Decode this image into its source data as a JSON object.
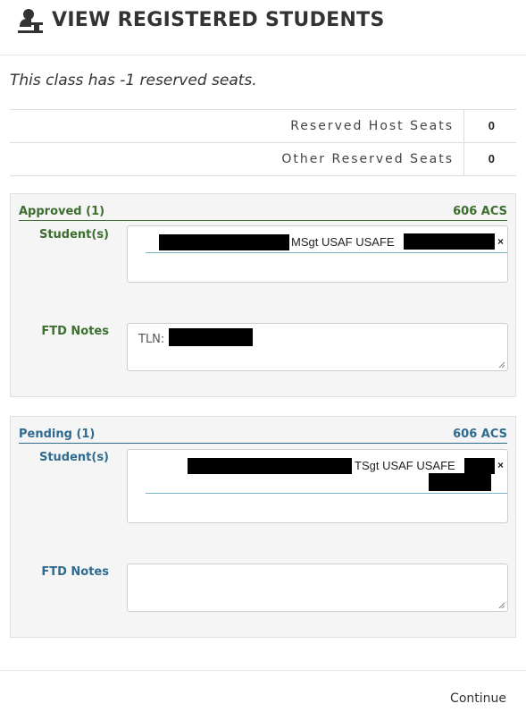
{
  "header": {
    "title": "VIEW REGISTERED STUDENTS",
    "icon": "user-podium-icon"
  },
  "subtitle": "This class has -1 reserved seats.",
  "seats": [
    {
      "label": "Reserved Host Seats",
      "value": "0"
    },
    {
      "label": "Other Reserved Seats",
      "value": "0"
    }
  ],
  "approved": {
    "heading": "Approved (1)",
    "unit": "606 ACS",
    "students_label": "Student(s)",
    "student_text": "MSgt USAF USAFE",
    "remove": "×",
    "notes_label": "FTD Notes",
    "notes_value": "TLN:"
  },
  "pending": {
    "heading": "Pending (1)",
    "unit": "606 ACS",
    "students_label": "Student(s)",
    "student_text": "TSgt USAF USAFE",
    "remove": "×",
    "notes_label": "FTD Notes",
    "notes_value": ""
  },
  "footer": {
    "continue_label": "Continue"
  },
  "colors": {
    "approved": "#3c6e2e",
    "pending": "#2f6b8f",
    "redaction": "#000000"
  }
}
